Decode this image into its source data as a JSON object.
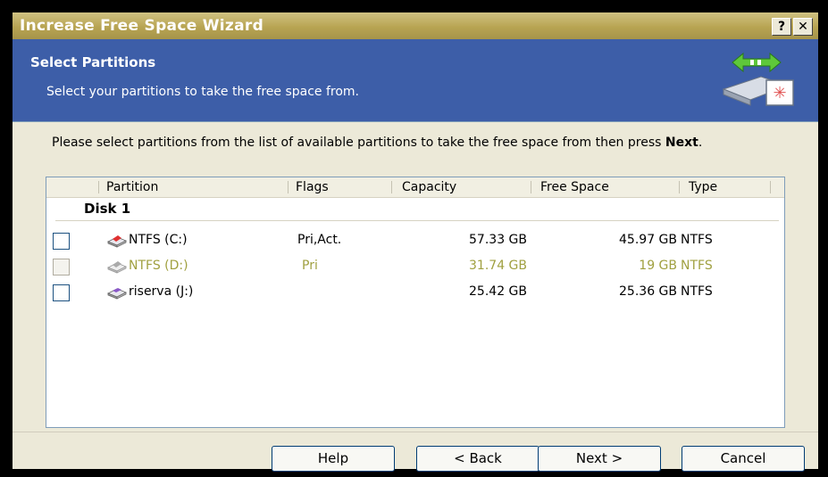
{
  "window": {
    "title": "Increase Free Space Wizard",
    "help_btn": "?",
    "close_btn": "✕"
  },
  "banner": {
    "heading": "Select Partitions",
    "subtitle": "Select your partitions to take the free space from."
  },
  "instructions": {
    "text": "Please select partitions from the list of available partitions to take the free space from then press ",
    "bold": "Next",
    "suffix": "."
  },
  "table": {
    "columns": [
      "Partition",
      "Flags",
      "Capacity",
      "Free Space",
      "Type"
    ],
    "group": "Disk 1",
    "rows": [
      {
        "name": "NTFS (C:)",
        "flags": "Pri,Act.",
        "capacity": "57.33 GB",
        "free": "45.97 GB",
        "type": "NTFS",
        "enabled": true,
        "icon": "drive-icon-red"
      },
      {
        "name": "NTFS (D:)",
        "flags": "Pri",
        "capacity": "31.74 GB",
        "free": "19 GB",
        "type": "NTFS",
        "enabled": false,
        "icon": "drive-icon-gray"
      },
      {
        "name": "riserva (J:)",
        "flags": "",
        "capacity": "25.42 GB",
        "free": "25.36 GB",
        "type": "NTFS",
        "enabled": true,
        "icon": "drive-icon-purple"
      }
    ]
  },
  "buttons": {
    "help": "Help",
    "back": "< Back",
    "next": "Next >",
    "cancel": "Cancel"
  },
  "colors": {
    "banner": "#3d5ea8",
    "titlebar": "#b8a452",
    "disabled_text": "#a0a040"
  }
}
